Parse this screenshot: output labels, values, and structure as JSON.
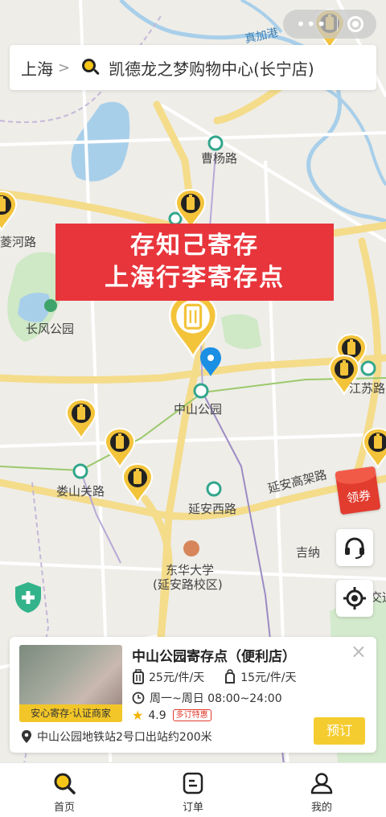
{
  "capsule": {
    "dots": "•••"
  },
  "search": {
    "city": "上海",
    "query": "凯德龙之梦购物中心(长宁店)"
  },
  "banner": {
    "line1": "存知己寄存",
    "line2": "上海行李寄存点"
  },
  "map": {
    "labels": {
      "caoyang": "曹杨路",
      "suhe": "菱河路",
      "changfeng": "长风公园",
      "zhongshan": "中山公园",
      "jiangsu": "江苏路",
      "loushan": "娄山关路",
      "yanan": "延安西路",
      "yanan_elevated": "延安高架路",
      "jina": "吉纳",
      "donghua": "东华大学",
      "donghua_campus": "(延安路校区)",
      "zhenjia": "真加港",
      "jiaotong": "交通"
    }
  },
  "side": {
    "coupon_label": "领券"
  },
  "card": {
    "thumb_tag": "安心寄存·认证商家",
    "name": "中山公园寄存点（便利店）",
    "price_large": "25元/件/天",
    "price_small": "15元/件/天",
    "hours": "周一~周日 08:00~24:00",
    "rating": "4.9",
    "promo": "多订特惠",
    "address": "中山公园地铁站2号口出站约200米",
    "book_label": "预订",
    "close": "×"
  },
  "tabs": [
    {
      "label": "首页"
    },
    {
      "label": "订单"
    },
    {
      "label": "我的"
    }
  ],
  "colors": {
    "brand_yellow": "#f5cc30",
    "banner_red": "#e8353c",
    "pin_blue": "#1a8fe3"
  }
}
